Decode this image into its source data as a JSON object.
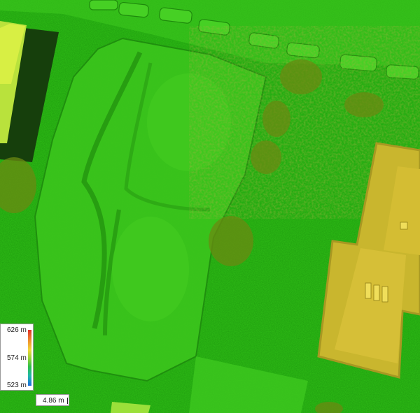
{
  "legend": {
    "max_label": "626 m",
    "mid_label": "574 m",
    "min_label": "523 m",
    "ramp_colors": [
      "#e0312b",
      "#f08a2c",
      "#f2d83a",
      "#8fd23a",
      "#2fc04a",
      "#22b9a8",
      "#1f6fe0"
    ]
  },
  "scale_bar": {
    "label": "4.86 m"
  },
  "colors": {
    "ground": "#2fbf16",
    "vegetation": "#5a7a12",
    "building": "#c9b62e",
    "field_strip": "#163f0c"
  }
}
